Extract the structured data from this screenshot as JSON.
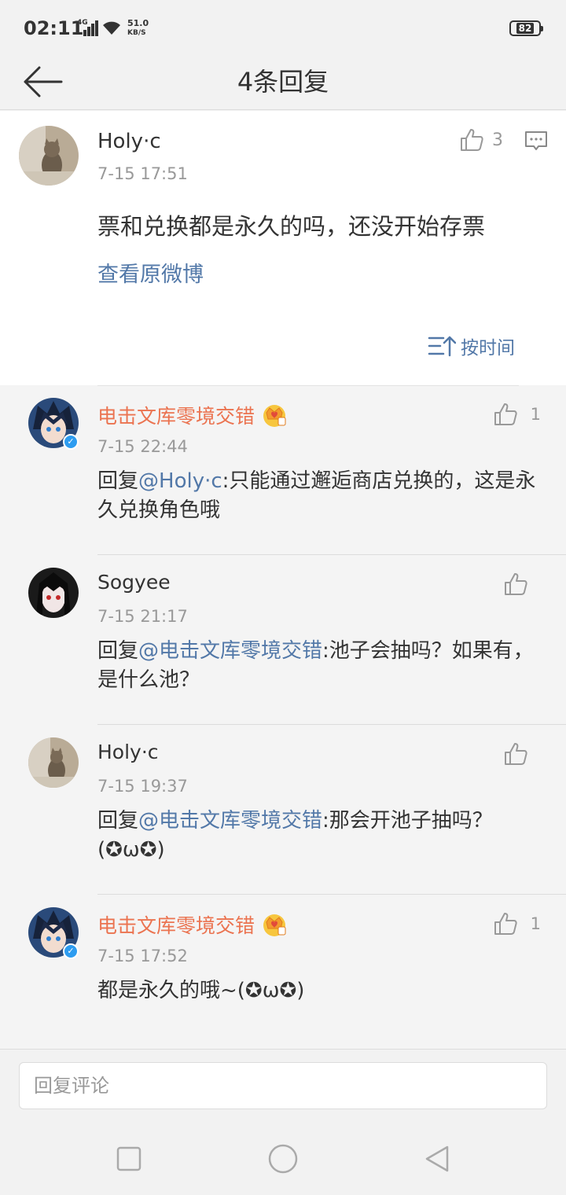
{
  "status_bar": {
    "time": "02:11",
    "network": "4G",
    "speed_value": "51.0",
    "speed_unit": "KB/S",
    "battery": "82"
  },
  "nav": {
    "title": "4条回复",
    "back_icon": "arrow-left-icon"
  },
  "main_comment": {
    "author": "Holy·c",
    "time": "7-15 17:51",
    "like_count": "3",
    "text": "票和兑换都是永久的吗，还没开始存票",
    "view_original_link": "查看原微博",
    "sort_label": "按时间"
  },
  "replies": [
    {
      "author": "电击文库零境交错",
      "vip": true,
      "verified": true,
      "time": "7-15 22:44",
      "like_count": "1",
      "prefix": "回复",
      "mention": "@Holy·c",
      "body": ":只能通过邂逅商店兑换的，这是永久兑换角色哦"
    },
    {
      "author": "Sogyee",
      "vip": false,
      "verified": false,
      "time": "7-15 21:17",
      "like_count": "",
      "prefix": "回复",
      "mention": "@电击文库零境交错",
      "body": ":池子会抽吗？如果有，是什么池？"
    },
    {
      "author": "Holy·c",
      "vip": false,
      "verified": false,
      "time": "7-15 19:37",
      "like_count": "",
      "prefix": "回复",
      "mention": "@电击文库零境交错",
      "body": ":那会开池子抽吗？(✪ω✪)"
    },
    {
      "author": "电击文库零境交错",
      "vip": true,
      "verified": true,
      "time": "7-15 17:52",
      "like_count": "1",
      "prefix": "",
      "mention": "",
      "body": "都是永久的哦~(✪ω✪)"
    }
  ],
  "reply_input": {
    "placeholder": "回复评论",
    "value": ""
  },
  "colors": {
    "accent_link": "#5278a8",
    "vip_name": "#eb7350",
    "verified": "#2d9cf0"
  }
}
